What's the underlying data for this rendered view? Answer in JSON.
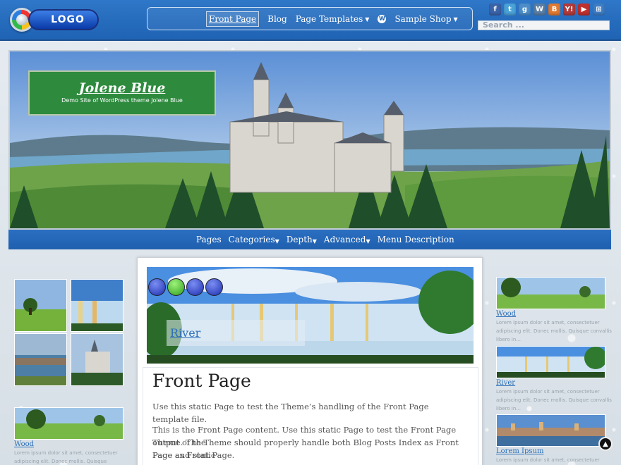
{
  "header": {
    "logo_text": "LOGO",
    "nav": [
      {
        "label": "Front Page",
        "active": true,
        "dropdown": false
      },
      {
        "label": "Blog",
        "active": false,
        "dropdown": false
      },
      {
        "label": "Page Templates",
        "active": false,
        "dropdown": true
      },
      {
        "label": "",
        "icon": "wordpress-icon",
        "active": false,
        "dropdown": false
      },
      {
        "label": "Sample Shop",
        "active": false,
        "dropdown": true
      }
    ],
    "social": [
      {
        "name": "facebook-icon",
        "glyph": "f",
        "color": "#3b63a8"
      },
      {
        "name": "twitter-icon",
        "glyph": "t",
        "color": "#4aa3d8"
      },
      {
        "name": "google-icon",
        "glyph": "g",
        "color": "#4d8ec9"
      },
      {
        "name": "wordpress-icon",
        "glyph": "W",
        "color": "#5a7fa6"
      },
      {
        "name": "blogger-icon",
        "glyph": "B",
        "color": "#e07a33"
      },
      {
        "name": "yahoo-icon",
        "glyph": "Y!",
        "color": "#b33a3a"
      },
      {
        "name": "youtube-icon",
        "glyph": "▶",
        "color": "#c0302e"
      },
      {
        "name": "windows-icon",
        "glyph": "⊞",
        "color": "#3f7dc4"
      }
    ],
    "search_placeholder": "Search ..."
  },
  "hero": {
    "site_title": "Jolene Blue",
    "site_description": "Demo Site of WordPress theme Jolene Blue"
  },
  "secondary_nav": [
    {
      "label": "Pages",
      "dropdown": false
    },
    {
      "label": "Categories",
      "dropdown": true
    },
    {
      "label": "Depth",
      "dropdown": true
    },
    {
      "label": "Advanced",
      "dropdown": true
    },
    {
      "label": "Menu Description",
      "dropdown": false
    }
  ],
  "left_sidebar": {
    "widget_caption": "Wood",
    "widget_text": "Lorem ipsum dolor sit amet, consectetuer adipiscing elit. Donec mollis. Quisque convallis"
  },
  "slider": {
    "caption": "River",
    "dots": 4,
    "active_dot": 1
  },
  "post": {
    "title": "Front Page",
    "paragraph_1": "Use this static Page to test the Theme’s handling of the Front Page template file.",
    "paragraph_2_line_1": "This is the Front Page content. Use this static Page to test the Front Page output of the",
    "paragraph_2_line_2": "Theme. The Theme should properly handle both Blog Posts Index as Front Page and static",
    "paragraph_2_line_3": "Page as Front Page."
  },
  "right_sidebar": [
    {
      "caption": "Wood",
      "text_1": "Lorem ipsum dolor sit amet, consectetuer",
      "text_2": "adipiscing elit. Donec mollis. Quisque convallis",
      "text_3": "libero in..."
    },
    {
      "caption": "River",
      "text_1": "Lorem ipsum dolor sit amet, consectetuer",
      "text_2": "adipiscing elit. Donec mollis. Quisque convallis",
      "text_3": "libero in..."
    },
    {
      "caption": "Lorem Ipsum",
      "text_1": "Lorem ipsum dolor sit amet, consectetuer",
      "text_2": "",
      "text_3": ""
    }
  ]
}
